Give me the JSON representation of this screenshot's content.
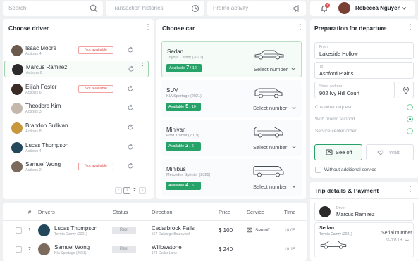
{
  "topbar": {
    "search_placeholder": "Search",
    "transactions_placeholder": "Transaction histories",
    "promo_placeholder": "Promo activity",
    "user_name": "Rebecca Nguyen",
    "notification_count": "1"
  },
  "drivers_panel": {
    "title": "Choose driver",
    "items": [
      {
        "name": "Isaac Moore",
        "actions": "Actions 4",
        "badge": "Not available",
        "avatar_color": "#6b5a4e"
      },
      {
        "name": "Marcus Ramirez",
        "actions": "Actions 6",
        "badge": "",
        "avatar_color": "#2d2a2c",
        "selected": true
      },
      {
        "name": "Elijah Foster",
        "actions": "Actions 6",
        "badge": "Not available",
        "avatar_color": "#3a2b25"
      },
      {
        "name": "Theodore Kim",
        "actions": "Actions 3",
        "badge": "",
        "avatar_color": "#c4b7ab"
      },
      {
        "name": "Brandon Sullivan",
        "actions": "Actions 8",
        "badge": "",
        "avatar_color": "#c9973b"
      },
      {
        "name": "Lucas Thompson",
        "actions": "Actions 4",
        "badge": "",
        "avatar_color": "#23485c"
      },
      {
        "name": "Samuel Wong",
        "actions": "Actions 2",
        "badge": "Not available",
        "avatar_color": "#7b6a5d"
      }
    ],
    "pagination": {
      "prev": "‹",
      "pages": [
        "1",
        "2"
      ],
      "next": "›"
    }
  },
  "cars_panel": {
    "title": "Choose car",
    "items": [
      {
        "type": "Sedan",
        "model": "Toyota Camry (2021)",
        "available_label": "Available",
        "available": "7",
        "total": "12",
        "select_label": "Select number"
      },
      {
        "type": "SUV",
        "model": "KIA Sportage (2021)",
        "available_label": "Available",
        "available": "5",
        "total": "10",
        "select_label": "Select number"
      },
      {
        "type": "Minivan",
        "model": "Ford Transit (2019)",
        "available_label": "Available",
        "available": "2",
        "total": "6",
        "select_label": "Select number"
      },
      {
        "type": "Minibus",
        "model": "Mercedes Sprinter (2020)",
        "available_label": "Available",
        "available": "4",
        "total": "6",
        "select_label": "Select number"
      }
    ]
  },
  "departure_panel": {
    "title": "Preparation for departure",
    "from_label": "From",
    "from_value": "Lakeside Hollow",
    "to_label": "To",
    "to_value": "Ashford Plains",
    "street_label": "Street address",
    "street_value": "902 Ivy Hill Court",
    "options": [
      {
        "label": "Customer request",
        "checked": false
      },
      {
        "label": "With promo support",
        "checked": true
      },
      {
        "label": "Service center order",
        "checked": false
      }
    ],
    "see_off_label": "See off",
    "wait_label": "Wait",
    "without_service_label": "Without additional service"
  },
  "trip_panel": {
    "title": "Trip details & Payment",
    "driver_label": "Driver",
    "driver_name": "Marcus Ramirez",
    "car_type": "Sedan",
    "car_model": "Toyota Camry (2021)",
    "serial_label": "Serial number",
    "serial_value": "56-008 1H"
  },
  "table": {
    "headers": {
      "num": "#",
      "drivers": "Drivers",
      "status": "Status",
      "direction": "Direction",
      "price": "Price",
      "service": "Service",
      "time": "Time"
    },
    "rows": [
      {
        "num": "1",
        "name": "Lucas Thompson",
        "car": "Toyota Camry (2021)",
        "status": "Rest",
        "direction": "Cedarbrook Falls",
        "address": "567 Oakridge Boulevard",
        "price": "$ 100",
        "service": "See off",
        "time": "10:05"
      },
      {
        "num": "2",
        "name": "Samuel Wong",
        "car": "KIA Sportage (2021)",
        "status": "Rest",
        "direction": "Willowstone",
        "address": "178 Cedar Lane",
        "price": "$ 240",
        "service": "",
        "time": "10:15"
      }
    ]
  },
  "colors": {
    "accent": "#27a36a",
    "danger": "#e05555",
    "background": "#eef0f2"
  }
}
